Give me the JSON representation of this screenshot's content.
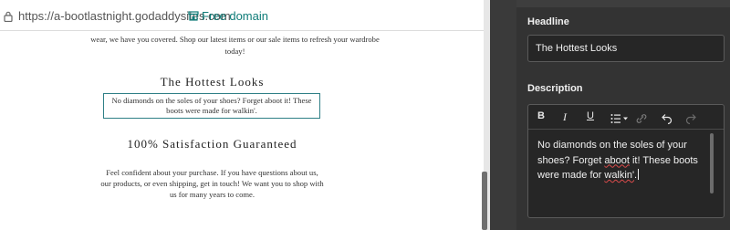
{
  "browser": {
    "url": "https://a-bootlastnight.godaddysites.com",
    "domain_link": "Free domain"
  },
  "site": {
    "intro_text": "wear, we have you covered. Shop our latest items or our sale items to refresh your wardrobe today!",
    "sections": [
      {
        "title": "The Hottest Looks",
        "text": "No diamonds on the soles of your shoes? Forget aboot it! These boots were made for walkin'."
      },
      {
        "title": "100% Satisfaction Guaranteed",
        "text": "Feel confident about your purchase. If you have questions about us, our products, or even shipping, get in touch! We want you to shop with us for many years to come."
      }
    ]
  },
  "editor": {
    "headline_label": "Headline",
    "headline_value": "The Hottest Looks",
    "description_label": "Description",
    "toolbar": {
      "bold": "B",
      "italic": "I",
      "underline": "U"
    },
    "description_parts": {
      "before_aboot": "No diamonds on the soles of your shoes? Forget ",
      "aboot": "aboot",
      "middle": " it! These boots were made for ",
      "walkin": "walkin'",
      "after": "."
    }
  },
  "colors": {
    "accent": "#0f7c78",
    "selection_border": "#2e7f86",
    "panel_bg": "#333333"
  }
}
